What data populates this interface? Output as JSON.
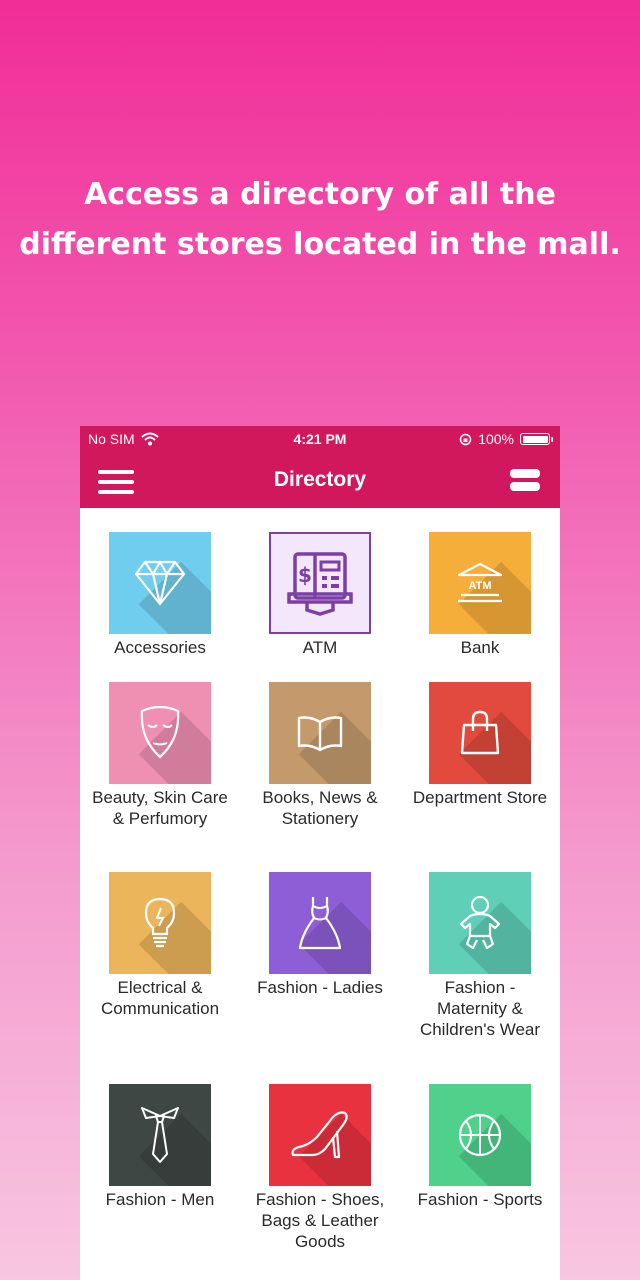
{
  "headline": {
    "line1": "Access a directory of all the",
    "line2": "different stores located in the mall."
  },
  "status_bar": {
    "carrier": "No SIM",
    "time": "4:21 PM",
    "battery": "100%"
  },
  "navbar": {
    "title": "Directory",
    "menu_icon": "hamburger-menu-icon",
    "list_icon": "list-view-icon"
  },
  "colors": {
    "brand": "#d2185d",
    "background_top": "#f12d98",
    "background_bottom": "#f8c6e1"
  },
  "categories": [
    {
      "label": "Accessories",
      "color": "#6fcdee",
      "icon": "diamond-icon"
    },
    {
      "label": "ATM",
      "color": "#f3e7fb",
      "icon": "atm-machine-icon"
    },
    {
      "label": "Bank",
      "color": "#f6ae3b",
      "icon": "bank-icon"
    },
    {
      "label": "Beauty, Skin Care & Perfumory",
      "color": "#ef8fb1",
      "icon": "face-mask-icon"
    },
    {
      "label": "Books, News & Stationery",
      "color": "#c49a6c",
      "icon": "book-icon"
    },
    {
      "label": "Department Store",
      "color": "#e14a3c",
      "icon": "shopping-bag-icon"
    },
    {
      "label": "Electrical & Communication",
      "color": "#ebb55b",
      "icon": "lightbulb-icon"
    },
    {
      "label": "Fashion - Ladies",
      "color": "#8e5ed6",
      "icon": "dress-icon"
    },
    {
      "label": "Fashion - Maternity & Children's Wear",
      "color": "#5fcfb7",
      "icon": "baby-icon"
    },
    {
      "label": "Fashion - Men",
      "color": "#3f4744",
      "icon": "tie-icon"
    },
    {
      "label": "Fashion - Shoes, Bags & Leather Goods",
      "color": "#e8323f",
      "icon": "high-heel-icon"
    },
    {
      "label": "Fashion - Sports",
      "color": "#4fd08b",
      "icon": "basketball-icon"
    }
  ]
}
